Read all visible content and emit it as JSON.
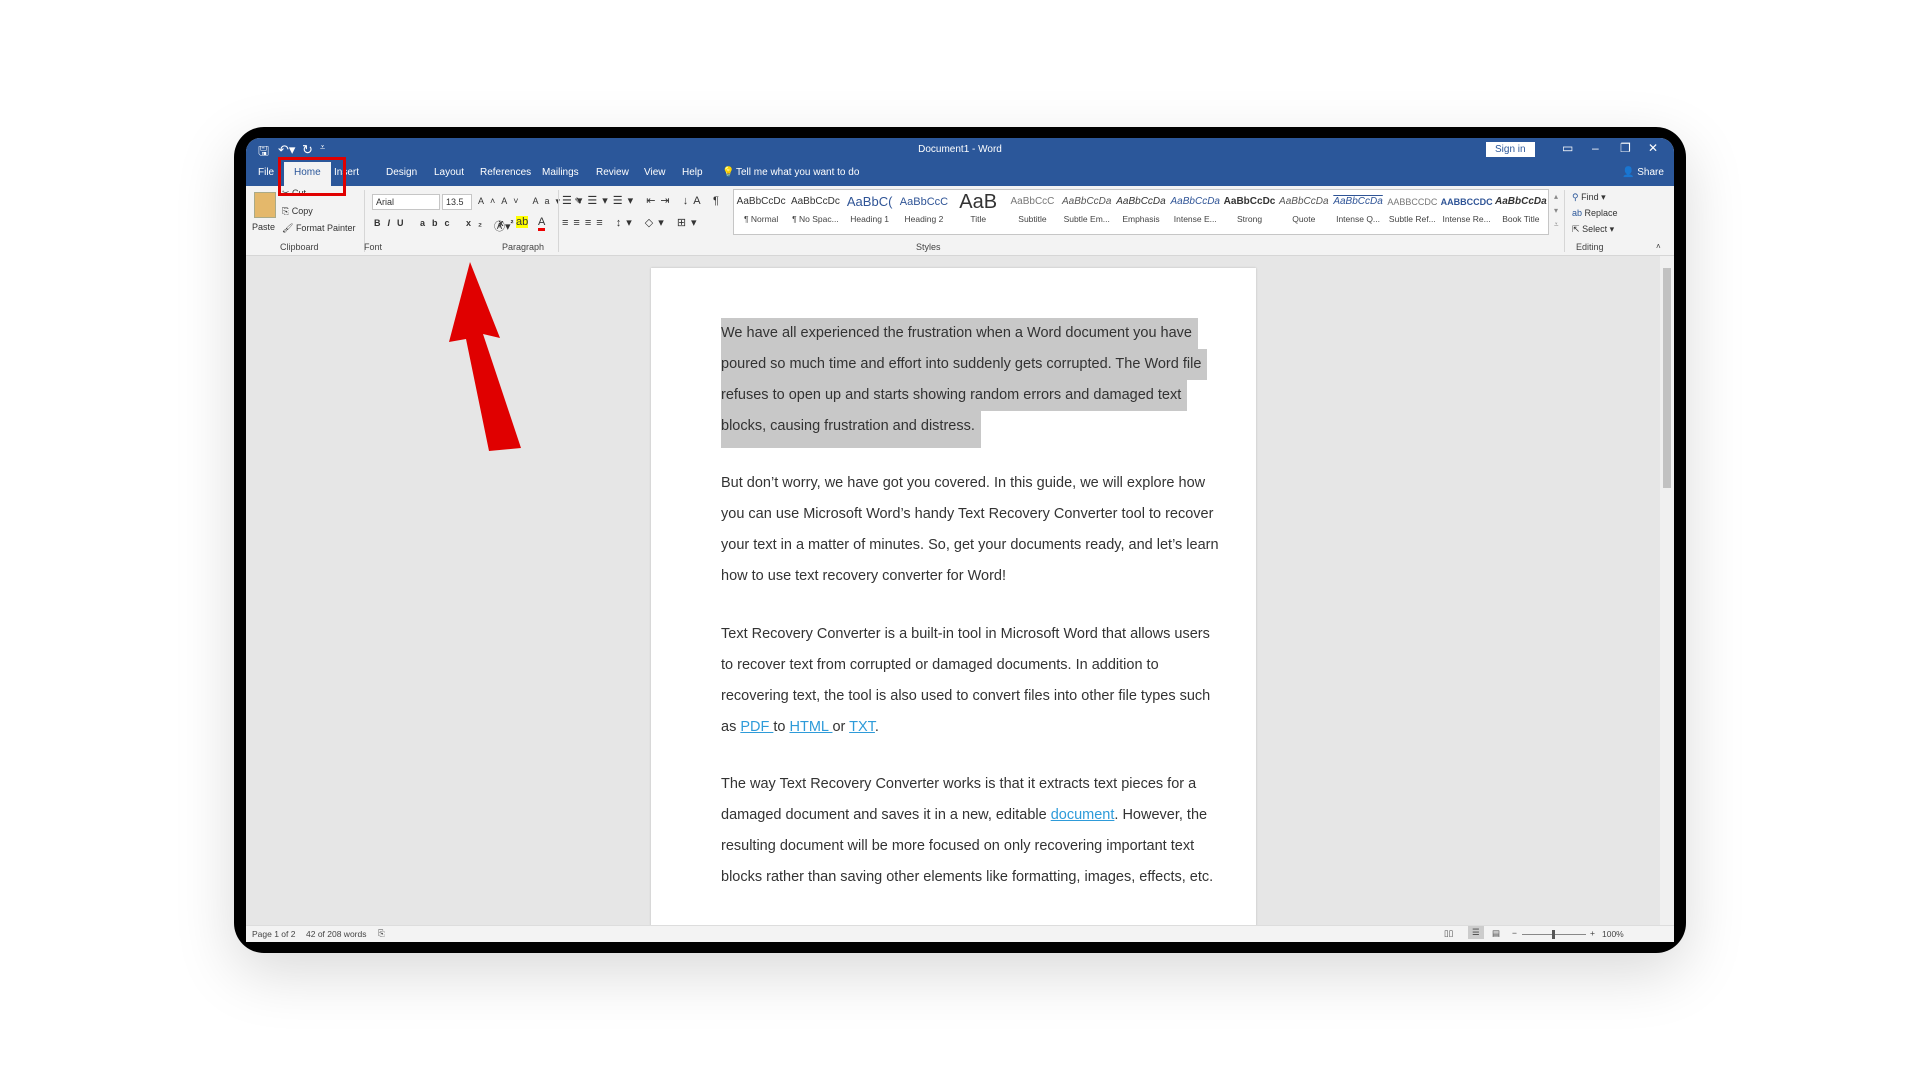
{
  "window": {
    "title": "Document1 - Word",
    "sign_in": "Sign in",
    "share": "Share"
  },
  "tabs": [
    "File",
    "Home",
    "Insert",
    "Design",
    "Layout",
    "References",
    "Mailings",
    "Review",
    "View",
    "Help"
  ],
  "tell_me": "Tell me what you want to do",
  "clipboard": {
    "paste": "Paste",
    "cut": "Cut",
    "copy": "Copy",
    "format_painter": "Format Painter",
    "label": "Clipboard"
  },
  "font": {
    "name": "Arial",
    "size": "13.5",
    "label": "Font"
  },
  "paragraph": {
    "label": "Paragraph"
  },
  "styles": {
    "label": "Styles",
    "items": [
      {
        "preview": "AaBbCcDc",
        "name": "¶ Normal"
      },
      {
        "preview": "AaBbCcDc",
        "name": "¶ No Spac..."
      },
      {
        "preview": "AaBbC(",
        "name": "Heading 1"
      },
      {
        "preview": "AaBbCcC",
        "name": "Heading 2"
      },
      {
        "preview": "AaB",
        "name": "Title"
      },
      {
        "preview": "AaBbCcC",
        "name": "Subtitle"
      },
      {
        "preview": "AaBbCcDa",
        "name": "Subtle Em..."
      },
      {
        "preview": "AaBbCcDa",
        "name": "Emphasis"
      },
      {
        "preview": "AaBbCcDa",
        "name": "Intense E..."
      },
      {
        "preview": "AaBbCcDc",
        "name": "Strong"
      },
      {
        "preview": "AaBbCcDa",
        "name": "Quote"
      },
      {
        "preview": "AaBbCcDa",
        "name": "Intense Q..."
      },
      {
        "preview": "AABBCCDC",
        "name": "Subtle Ref..."
      },
      {
        "preview": "AABBCCDC",
        "name": "Intense Re..."
      },
      {
        "preview": "AaBbCcDa",
        "name": "Book Title"
      }
    ]
  },
  "editing": {
    "find": "Find",
    "replace": "Replace",
    "select": "Select",
    "label": "Editing"
  },
  "document": {
    "p1": [
      "We have all experienced the frustration when a Word document you have",
      "poured so much time and effort into suddenly gets corrupted. The Word file",
      "refuses to open up and starts showing random errors and damaged text",
      "blocks, causing frustration and distress."
    ],
    "p2": [
      "But don’t worry, we have got you covered. In this guide, we will explore how",
      "you can use Microsoft Word’s handy Text Recovery Converter tool to recover",
      "your text in a matter of minutes. So, get your documents ready, and let’s learn",
      "how to use text recovery converter for Word!"
    ],
    "p3": [
      "Text Recovery Converter is a built-in tool in Microsoft Word that allows users",
      "to recover text from corrupted or damaged documents. In addition to",
      "recovering text, the tool is also used to convert files into other file types such"
    ],
    "p3_last": {
      "as": "as ",
      "pdf": "PDF ",
      "to": " to ",
      "html": "HTML ",
      "or": " or ",
      "txt": "TXT",
      "end": "."
    },
    "p4": [
      "The way Text Recovery Converter works is that it extracts text pieces for a"
    ],
    "p4_l2": {
      "a": "damaged document and saves it in a new, editable ",
      "link": "document",
      "b": ". However, the"
    },
    "p4_rest": [
      "resulting document will be more focused on only recovering important text",
      "blocks rather than saving other elements like formatting, images, effects, etc."
    ]
  },
  "status": {
    "page": "Page 1 of 2",
    "words": "42 of 208 words",
    "zoom": "100%"
  },
  "colors": {
    "accent": "#2b579a",
    "annotation": "#e00000",
    "link": "#2e9bd9"
  }
}
